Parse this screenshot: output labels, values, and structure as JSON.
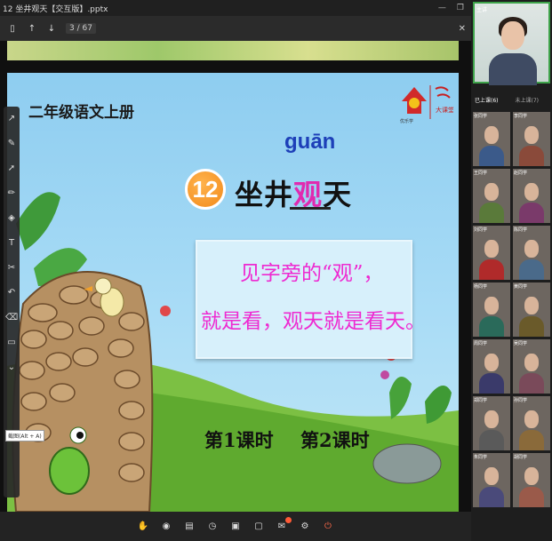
{
  "window": {
    "title": "12 坐井观天【交互版】.pptx"
  },
  "toolbar": {
    "page_current": "3",
    "page_total": "/ 67"
  },
  "slide": {
    "grade": "二年级语文上册",
    "logo_text": "优乐学 大课堂",
    "pinyin": "guān",
    "lesson_number": "12",
    "title_before": "坐井",
    "title_highlight": "观",
    "title_after": "天",
    "explain_line1": "见字旁的“观”，",
    "explain_line2": "就是看，观天就是看天。",
    "lesson1_button": "第1课时",
    "lesson2_button": "第2课时"
  },
  "tools": {
    "tooltip": "截图(Alt + A)"
  },
  "participants": {
    "tabs": [
      "已上课(6)",
      "未上课(7)"
    ],
    "teacher_label": "主讲",
    "students": [
      {
        "name": "张同学",
        "color": "#3b5a8a"
      },
      {
        "name": "李同学",
        "color": "#8a4a3a"
      },
      {
        "name": "王同学",
        "color": "#5a7a3a"
      },
      {
        "name": "赵同学",
        "color": "#7a3a6a"
      },
      {
        "name": "刘同学",
        "color": "#b02a2a"
      },
      {
        "name": "陈同学",
        "color": "#4a6a8a"
      },
      {
        "name": "杨同学",
        "color": "#2a6a5a"
      },
      {
        "name": "黄同学",
        "color": "#6a5a2a"
      },
      {
        "name": "周同学",
        "color": "#3a3a6a"
      },
      {
        "name": "吴同学",
        "color": "#7a4a5a"
      },
      {
        "name": "郑同学",
        "color": "#5a5a5a"
      },
      {
        "name": "孙同学",
        "color": "#8a6a3a"
      },
      {
        "name": "朱同学",
        "color": "#4a4a7a"
      },
      {
        "name": "胡同学",
        "color": "#9a5a4a"
      }
    ]
  },
  "colors": {
    "highlight": "#e02ab0",
    "explain_text": "#ee2ad1",
    "pinyin": "#1d3fb8"
  }
}
